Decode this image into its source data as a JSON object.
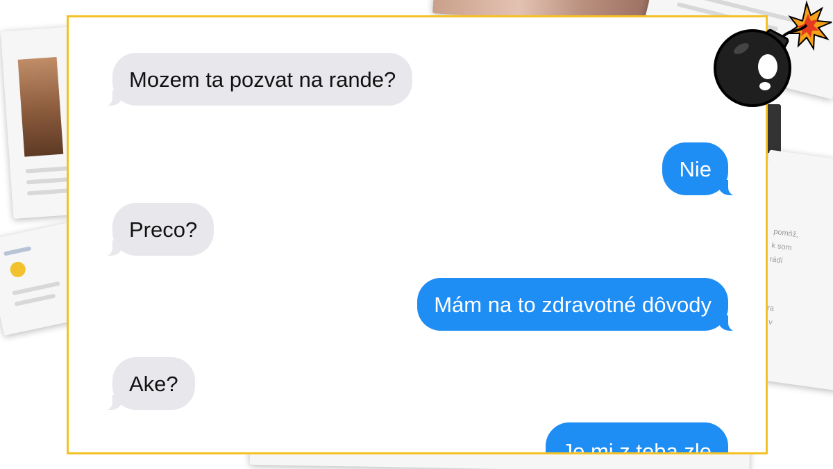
{
  "conversation": {
    "messages": [
      {
        "direction": "received",
        "text": "Mozem ta pozvat na rande?"
      },
      {
        "direction": "sent",
        "text": "Nie"
      },
      {
        "direction": "received",
        "text": "Preco?"
      },
      {
        "direction": "sent",
        "text": "Mám na to zdravotné dôvody"
      },
      {
        "direction": "received",
        "text": "Ake?"
      },
      {
        "direction": "sent",
        "text": "Je mi z teba zle"
      }
    ]
  },
  "background_cards": {
    "right_card_lines": [
      "pomôž,",
      "k som",
      "rádí",
      "ora",
      "ly v"
    ]
  },
  "logo": {
    "icon": "bomb-icon"
  },
  "colors": {
    "frame_border": "#f4c124",
    "received_bubble": "#e7e7ec",
    "sent_bubble": "#1e8df4"
  }
}
